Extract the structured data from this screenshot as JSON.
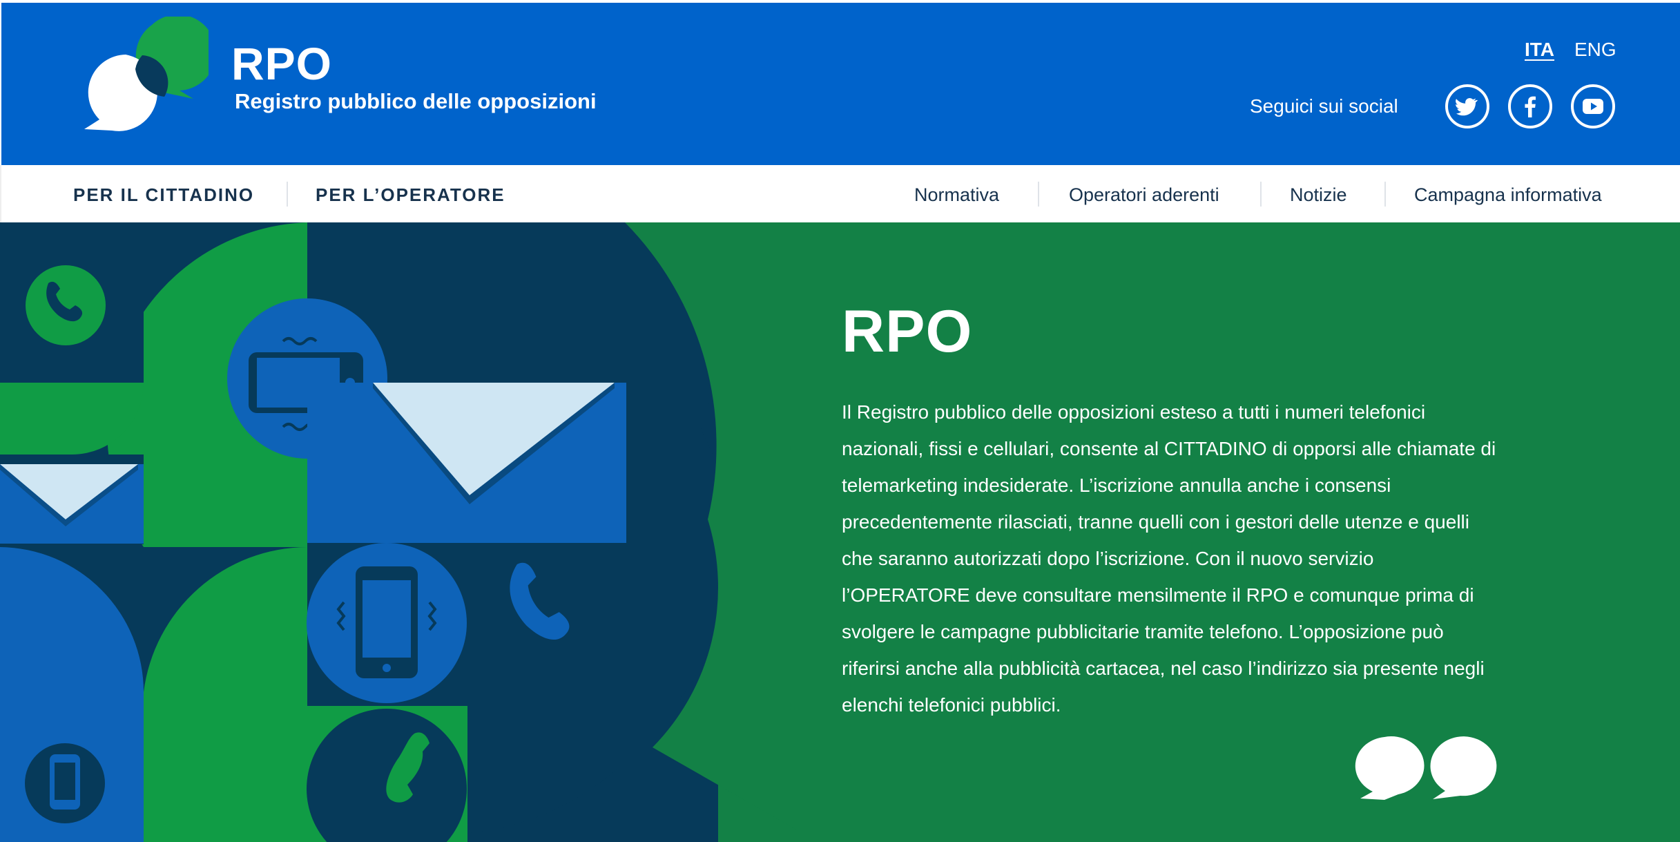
{
  "header": {
    "brand_title": "RPO",
    "brand_subtitle": "Registro pubblico delle opposizioni",
    "languages": [
      "ITA",
      "ENG"
    ],
    "active_language": "ITA",
    "social_label": "Seguici sui social",
    "social_icons": [
      "twitter-icon",
      "facebook-icon",
      "youtube-icon"
    ]
  },
  "nav": {
    "main": [
      "PER IL CITTADINO",
      "PER L’OPERATORE"
    ],
    "secondary": [
      "Normativa",
      "Operatori aderenti",
      "Notizie",
      "Campagna informativa"
    ]
  },
  "hero": {
    "title": "RPO",
    "text": "Il Registro pubblico delle opposizioni esteso a tutti i numeri telefonici nazionali, fissi e cellulari, consente al CITTADINO di opporsi alle chiamate di telemarketing indesiderate. L’iscrizione annulla anche i consensi precedentemente rilasciati, tranne quelli con i gestori delle utenze e quelli che saranno autorizzati dopo l’iscrizione. Con il nuovo servizio l’OPERATORE deve consultare mensilmente il RPO e comunque prima di svolgere le campagne pubblicitarie tramite telefono. L’opposizione può riferirsi anche alla pubblicità cartacea, nel caso l’indirizzo sia presente negli elenchi telefonici pubblici."
  },
  "colors": {
    "header_blue": "#0063cb",
    "hero_green": "#138146",
    "bright_green": "#109c45",
    "navy": "#063a5a",
    "mid_blue": "#0e63b8",
    "nav_text": "#17324d"
  }
}
